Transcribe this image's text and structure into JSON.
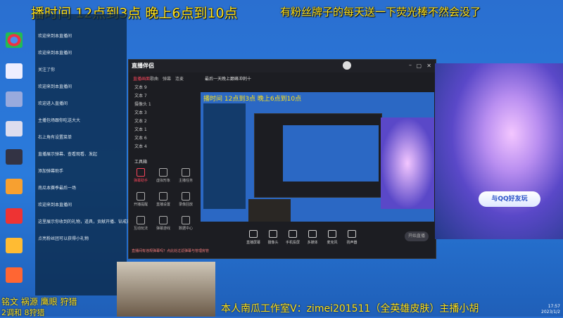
{
  "overlay": {
    "top_caption": "播时间 12点到3点 晚上6点到10点",
    "right_caption": "有粉丝牌子的每天送一下荧光棒不然会没了",
    "bottom_caption": "本人南瓜工作室V：zimei201511（全英雄皮肤）主播小胡",
    "bottom_left_1": "铭文 祸源 鹰眼 狩猎",
    "bottom_left_2": "2调和 8狩猎"
  },
  "chat": {
    "lines": [
      {
        "name": "",
        "text": "欢迎来到本直播间"
      },
      {
        "name": "",
        "text": "欢迎来到本直播间"
      },
      {
        "name": "",
        "text": "关注了你"
      },
      {
        "name": "",
        "text": "欢迎来到本直播间"
      },
      {
        "name": "",
        "text": "欢迎进入直播间"
      },
      {
        "name": "",
        "text": "主播包场跟你吃送大大"
      },
      {
        "name": "",
        "text": "右上角有设置菜单"
      },
      {
        "name": "",
        "text": "直播展示弹幕、查看观看、发起"
      },
      {
        "name": "",
        "text": "添加弹幕助手"
      },
      {
        "name": "",
        "text": "南瓜本赛季最后一场"
      },
      {
        "name": "",
        "text": "欢迎来到本直播间"
      },
      {
        "name": "",
        "text": "这里展示你收到的礼物，道具，贡献开播、钻戒开播"
      },
      {
        "name": "",
        "text": "点亮粉丝团可以获得小礼物"
      }
    ]
  },
  "app": {
    "logo": "直播伴侣",
    "tabs": [
      "直播画面",
      "歌曲",
      "弹幕",
      "连麦"
    ],
    "scene_title": "最后一天晚上巅峰冲刺十",
    "scenes": [
      "文本 9",
      "文本 7",
      "摄像头 1",
      "文本 3",
      "文本 2",
      "文本 1",
      "文本 6",
      "文本 4"
    ],
    "tools_title": "工具箱",
    "tools": [
      {
        "label": "弹幕助手",
        "red": true
      },
      {
        "label": "虚拟形象",
        "red": false
      },
      {
        "label": "主播任务",
        "red": false
      },
      {
        "label": "开播提醒",
        "red": false
      },
      {
        "label": "直播设置",
        "red": false
      },
      {
        "label": "录像回放",
        "red": false
      },
      {
        "label": "互动玩法",
        "red": false
      },
      {
        "label": "弹幕游戏",
        "red": false
      },
      {
        "label": "数据中心",
        "red": false
      }
    ],
    "bottom": [
      "直播屏幕",
      "摄像头",
      "手机投屏",
      "多媒体",
      "麦克风",
      "扬声器"
    ],
    "start_label": "开始直播",
    "footer": "直播间有违规弹幕吗？点此处过滤弹幕与管理房管"
  },
  "art": {
    "qq_button": "与QQ好友玩"
  },
  "taskbar": {
    "time": "17:57",
    "date": "2023/1/2"
  },
  "colors": {
    "caption": "#ffe11a",
    "accent": "#f5455a"
  }
}
